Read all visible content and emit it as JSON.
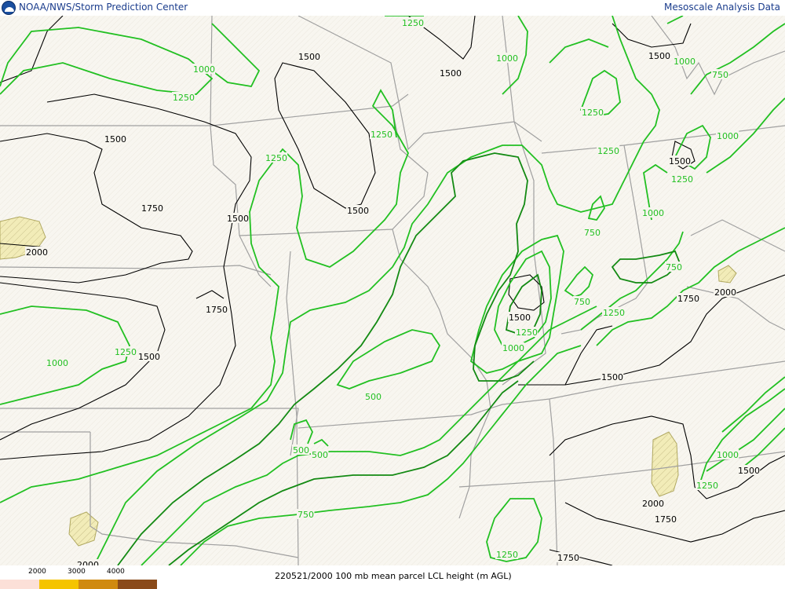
{
  "header": {
    "left_title": "NOAA/NWS/Storm Prediction Center",
    "right_title": "Mesoscale Analysis Data"
  },
  "footer": {
    "caption": "220521/2000 100 mb mean parcel LCL height (m AGL)",
    "legend_ticks": [
      "2000",
      "3000",
      "4000"
    ],
    "legend_colors": [
      "#fce0d8",
      "#f5c400",
      "#d08a10",
      "#8a4a1a"
    ]
  },
  "map": {
    "colors": {
      "background": "#f7f5ee",
      "state_lines": "#a0a0a0",
      "contour_black": "#000000",
      "contour_green_light": "#22c022",
      "contour_green_dark": "#138a13",
      "shade_2000": "#f2ecb8"
    },
    "contour_labels": [
      {
        "text": "1250",
        "color": "green"
      },
      {
        "text": "1000",
        "color": "green"
      },
      {
        "text": "1250",
        "color": "green"
      },
      {
        "text": "1500",
        "color": "black"
      },
      {
        "text": "1500",
        "color": "black"
      },
      {
        "text": "1500",
        "color": "black"
      },
      {
        "text": "1250",
        "color": "green"
      },
      {
        "text": "1250",
        "color": "green"
      },
      {
        "text": "1750",
        "color": "black"
      },
      {
        "text": "1500",
        "color": "black"
      },
      {
        "text": "1500",
        "color": "black"
      },
      {
        "text": "2000",
        "color": "black"
      },
      {
        "text": "1750",
        "color": "black"
      },
      {
        "text": "1500",
        "color": "black"
      },
      {
        "text": "1250",
        "color": "green"
      },
      {
        "text": "1000",
        "color": "green"
      },
      {
        "text": "500",
        "color": "green"
      },
      {
        "text": "500",
        "color": "green"
      },
      {
        "text": "500",
        "color": "green"
      },
      {
        "text": "750",
        "color": "green"
      },
      {
        "text": "2000",
        "color": "black"
      },
      {
        "text": "1000",
        "color": "green"
      },
      {
        "text": "1500",
        "color": "black"
      },
      {
        "text": "1000",
        "color": "green"
      },
      {
        "text": "750",
        "color": "green"
      },
      {
        "text": "1250",
        "color": "green"
      },
      {
        "text": "1250",
        "color": "green"
      },
      {
        "text": "1000",
        "color": "green"
      },
      {
        "text": "1500",
        "color": "black"
      },
      {
        "text": "1250",
        "color": "green"
      },
      {
        "text": "1000",
        "color": "green"
      },
      {
        "text": "750",
        "color": "green"
      },
      {
        "text": "750",
        "color": "green"
      },
      {
        "text": "750",
        "color": "green"
      },
      {
        "text": "1250",
        "color": "green"
      },
      {
        "text": "1500",
        "color": "black"
      },
      {
        "text": "1250",
        "color": "green"
      },
      {
        "text": "1000",
        "color": "green"
      },
      {
        "text": "1750",
        "color": "black"
      },
      {
        "text": "2000",
        "color": "black"
      },
      {
        "text": "1500",
        "color": "black"
      },
      {
        "text": "1000",
        "color": "green"
      },
      {
        "text": "1500",
        "color": "black"
      },
      {
        "text": "1250",
        "color": "green"
      },
      {
        "text": "2000",
        "color": "black"
      },
      {
        "text": "1750",
        "color": "black"
      },
      {
        "text": "1250",
        "color": "green"
      },
      {
        "text": "1750",
        "color": "black"
      }
    ]
  }
}
